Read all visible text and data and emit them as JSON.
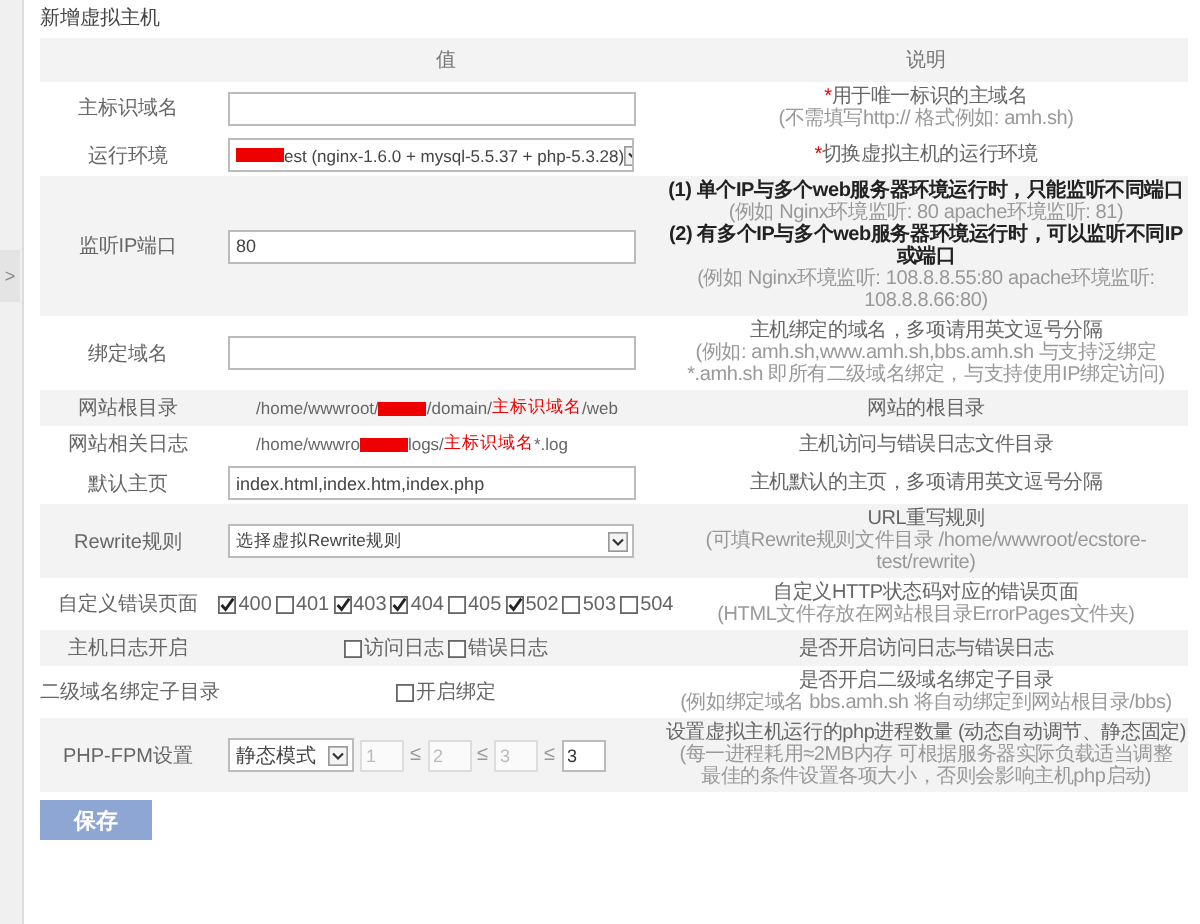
{
  "side_tab": {
    "glyph": ">"
  },
  "title": "新增虚拟主机",
  "columns": [
    "值",
    "说明"
  ],
  "rows": [
    {
      "label": "主标识域名",
      "shaded": false,
      "kind": "input",
      "value": "",
      "desc": [
        {
          "kind": "note",
          "required_mark": "*",
          "text": "用于唯一标识的主域名"
        },
        {
          "kind": "hint",
          "text": "(不需填写http:// 格式例如: amh.sh)"
        }
      ]
    },
    {
      "label": "运行环境",
      "shaded": false,
      "kind": "select",
      "segments": [
        {
          "kind": "redacted"
        },
        {
          "kind": "text",
          "text": "est (nginx-1.6.0 + mysql-5.5.37 + php-5.3.28)"
        }
      ],
      "desc": [
        {
          "kind": "note",
          "required_mark": "*",
          "text": "切换虚拟主机的运行环境"
        }
      ]
    },
    {
      "label": "监听IP端口",
      "shaded": true,
      "kind": "input",
      "value": "80",
      "desc": [
        {
          "kind": "strong",
          "text": "(1) 单个IP与多个web服务器环境运行时，只能监听不同端口"
        },
        {
          "kind": "hint",
          "text": "(例如 Nginx环境监听: 80  apache环境监听: 81)"
        },
        {
          "kind": "strong",
          "text": "(2) 有多个IP与多个web服务器环境运行时，可以监听不同IP或端口"
        },
        {
          "kind": "hint",
          "text": "(例如 Nginx环境监听: 108.8.8.55:80  apache环境监听: 108.8.8.66:80)"
        }
      ]
    },
    {
      "label": "绑定域名",
      "shaded": false,
      "kind": "input",
      "value": "",
      "desc": [
        {
          "kind": "note",
          "text": "主机绑定的域名，多项请用英文逗号分隔"
        },
        {
          "kind": "hint",
          "text": "(例如: amh.sh,www.amh.sh,bbs.amh.sh 与支持泛绑定"
        },
        {
          "kind": "hint",
          "text": "*.amh.sh 即所有二级域名绑定，与支持使用IP绑定访问)"
        }
      ]
    },
    {
      "label": "网站根目录",
      "shaded": true,
      "kind": "path",
      "segments": [
        {
          "kind": "text",
          "text": "/home/wwwroot/"
        },
        {
          "kind": "redacted"
        },
        {
          "kind": "text",
          "text": "/domain/"
        },
        {
          "kind": "highlight",
          "text": "主标识域名"
        },
        {
          "kind": "text",
          "text": "/web"
        }
      ],
      "desc": [
        {
          "kind": "note",
          "text": "网站的根目录"
        }
      ]
    },
    {
      "label": "网站相关日志",
      "shaded": false,
      "kind": "path",
      "segments": [
        {
          "kind": "text",
          "text": "/home/wwwro"
        },
        {
          "kind": "redacted"
        },
        {
          "kind": "text",
          "text": "logs/"
        },
        {
          "kind": "highlight",
          "text": "主标识域名"
        },
        {
          "kind": "text",
          "text": "*.log"
        }
      ],
      "desc": [
        {
          "kind": "note",
          "text": "主机访问与错误日志文件目录"
        }
      ]
    },
    {
      "label": "默认主页",
      "shaded": false,
      "kind": "input",
      "value": "index.html,index.htm,index.php",
      "desc": [
        {
          "kind": "note",
          "text": "主机默认的主页，多项请用英文逗号分隔"
        }
      ]
    },
    {
      "label": "Rewrite规则",
      "shaded": true,
      "kind": "select",
      "segments": [
        {
          "kind": "text",
          "text": "选择虚拟Rewrite规则"
        }
      ],
      "desc": [
        {
          "kind": "note",
          "text": "URL重写规则"
        },
        {
          "kind": "hint",
          "text": "(可填Rewrite规则文件目录 /home/wwwroot/ecstore-test/rewrite)"
        }
      ]
    },
    {
      "label": "自定义错误页面",
      "shaded": false,
      "kind": "checks",
      "checks": [
        {
          "label": "400",
          "checked": true
        },
        {
          "label": "401",
          "checked": false
        },
        {
          "label": "403",
          "checked": true
        },
        {
          "label": "404",
          "checked": true
        },
        {
          "label": "405",
          "checked": false
        },
        {
          "label": "502",
          "checked": true
        },
        {
          "label": "503",
          "checked": false
        },
        {
          "label": "504",
          "checked": false
        }
      ],
      "desc": [
        {
          "kind": "note",
          "text": "自定义HTTP状态码对应的错误页面"
        },
        {
          "kind": "hint",
          "text": "(HTML文件存放在网站根目录ErrorPages文件夹)"
        }
      ]
    },
    {
      "label": "主机日志开启",
      "shaded": true,
      "kind": "checks",
      "checks": [
        {
          "label": "访问日志",
          "checked": false
        },
        {
          "label": "错误日志",
          "checked": false
        }
      ],
      "desc": [
        {
          "kind": "note",
          "text": "是否开启访问日志与错误日志"
        }
      ]
    },
    {
      "label": "二级域名绑定子目录",
      "shaded": false,
      "kind": "checks",
      "checks": [
        {
          "label": "开启绑定",
          "checked": false
        }
      ],
      "desc": [
        {
          "kind": "note",
          "text": "是否开启二级域名绑定子目录"
        },
        {
          "kind": "hint",
          "text": "(例如绑定域名 bbs.amh.sh 将自动绑定到网站根目录/bbs)"
        }
      ]
    },
    {
      "label": "PHP-FPM设置",
      "shaded": true,
      "kind": "fpm",
      "mode": "静态模式",
      "separator": "≤",
      "numbers": [
        {
          "value": "1",
          "disabled": true
        },
        {
          "value": "2",
          "disabled": true
        },
        {
          "value": "3",
          "disabled": true
        },
        {
          "value": "3",
          "disabled": false
        }
      ],
      "desc": [
        {
          "kind": "note",
          "text": "设置虚拟主机运行的php进程数量 (动态自动调节、静态固定)"
        },
        {
          "kind": "hint",
          "text": "(每一进程耗用≈2MB内存 可根据服务器实际负载适当调整"
        },
        {
          "kind": "hint",
          "text": "最佳的条件设置各项大小，否则会影响主机php启动)"
        }
      ]
    }
  ],
  "save_button": "保存"
}
